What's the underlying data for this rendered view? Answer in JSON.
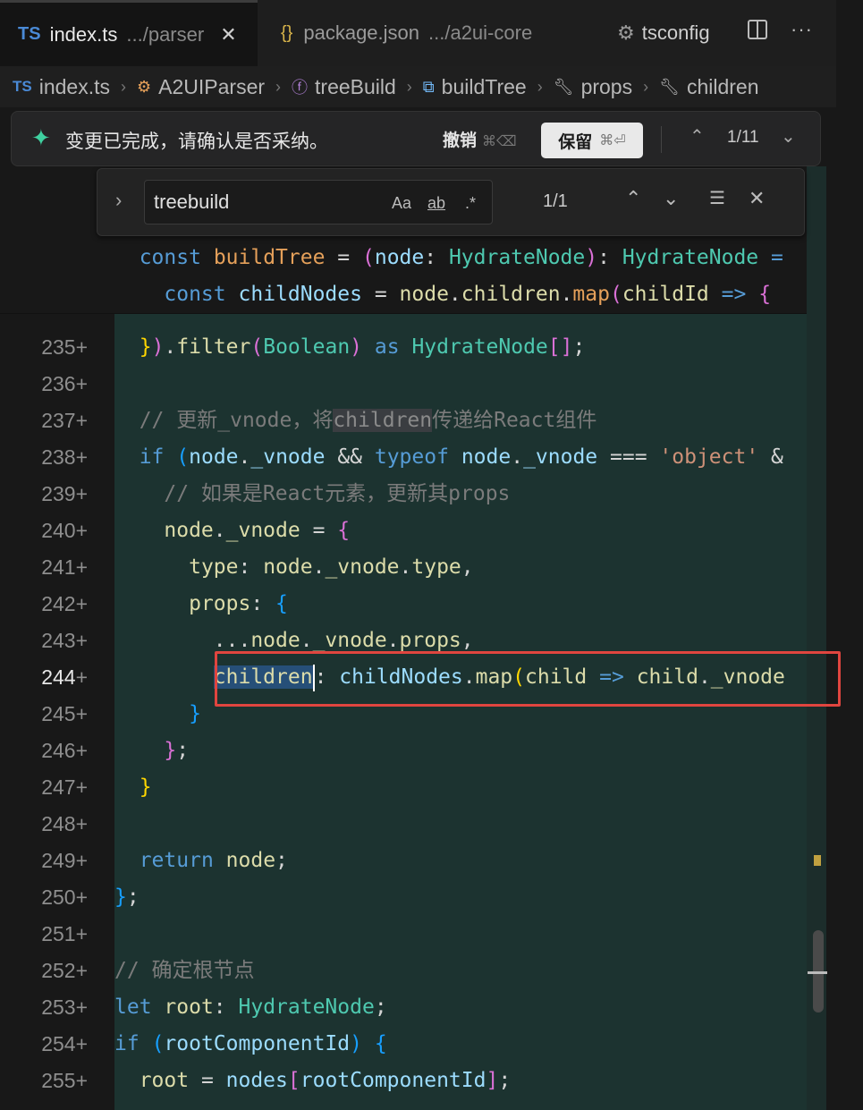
{
  "tabs": [
    {
      "icon": "TS",
      "name": "index.ts",
      "path": ".../parser",
      "active": true
    },
    {
      "icon": "{}",
      "name": "package.json",
      "path": ".../a2ui-core",
      "active": false
    },
    {
      "icon": "gear",
      "name": "tsconfig",
      "path": "",
      "active": false
    }
  ],
  "breadcrumb": [
    "index.ts",
    "A2UIParser",
    "treeBuild",
    "buildTree",
    "props",
    "children"
  ],
  "ai_bar": {
    "message": "变更已完成，请确认是否采纳。",
    "undo_label": "撤销",
    "undo_key": "⌘⌫",
    "keep_label": "保留",
    "keep_key": "⌘⏎",
    "counter": "1/11"
  },
  "find": {
    "query": "treebuild",
    "opt_case": "Aa",
    "opt_word": "ab",
    "opt_regex": ".*",
    "result": "1/1"
  },
  "sticky": [
    "const buildTree = (node: HydrateNode): HydrateNode =",
    "  const childNodes = node.children.map(childId => {"
  ],
  "gutter": [
    "235",
    "236",
    "237",
    "238",
    "239",
    "240",
    "241",
    "242",
    "243",
    "244",
    "245",
    "246",
    "247",
    "248",
    "249",
    "250",
    "251",
    "252",
    "253",
    "254",
    "255"
  ],
  "current_line": "244",
  "code": {
    "l235": "}).filter(Boolean) as HydrateNode[];",
    "c237a": "// 更新_vnode，将",
    "c237b": "children",
    "c237c": "传递给React组件",
    "c239": "// 如果是React元素，更新其props",
    "c252": "// 确定根节点"
  }
}
